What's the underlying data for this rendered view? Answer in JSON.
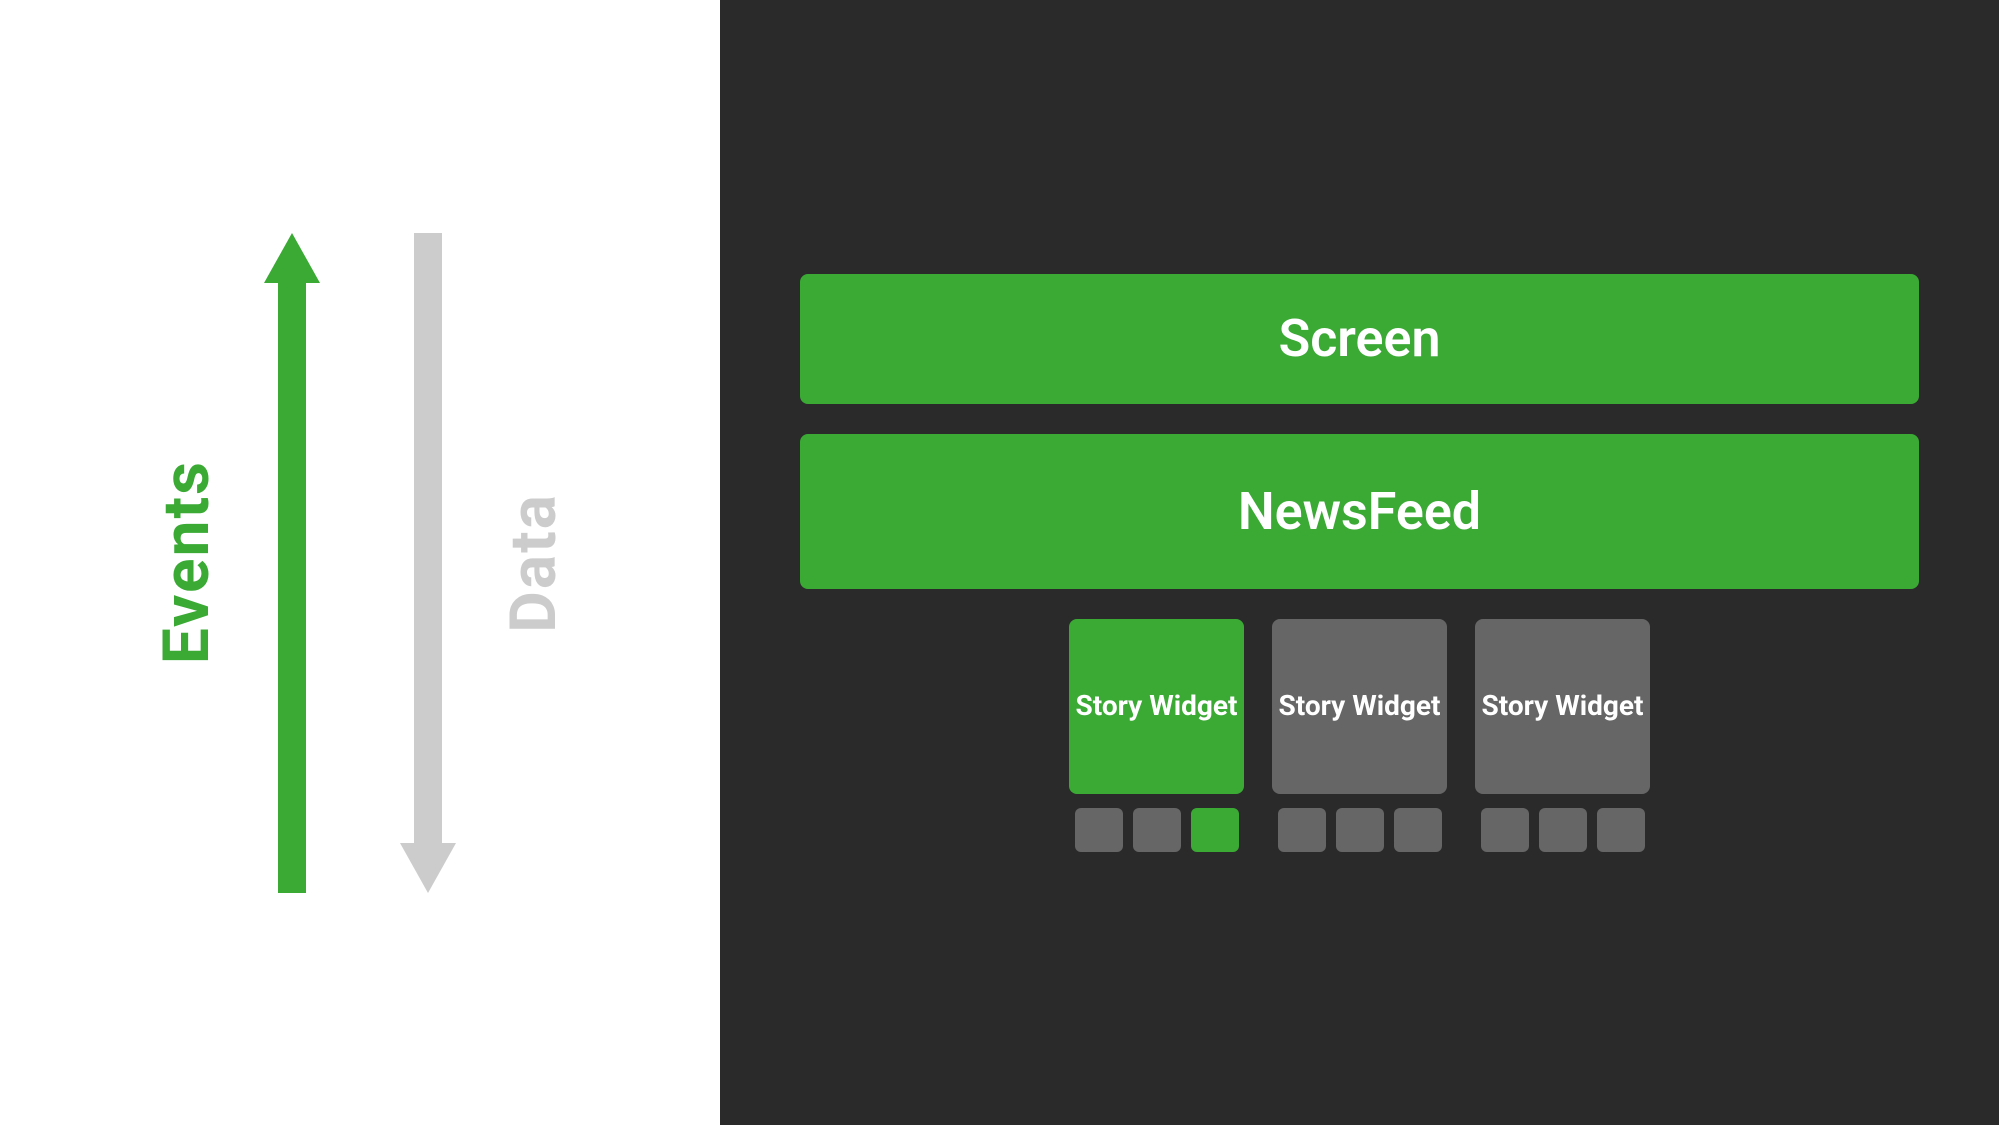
{
  "left": {
    "events_label": "Events",
    "data_label": "Data"
  },
  "right": {
    "screen_label": "Screen",
    "newsfeed_label": "NewsFeed",
    "story_widgets": [
      {
        "label": "Story Widget",
        "color": "green",
        "dots": [
          "gray",
          "gray",
          "green"
        ]
      },
      {
        "label": "Story Widget",
        "color": "gray",
        "dots": [
          "gray",
          "gray",
          "gray"
        ]
      },
      {
        "label": "Story Widget",
        "color": "gray",
        "dots": [
          "gray",
          "gray",
          "gray"
        ]
      }
    ]
  },
  "colors": {
    "green": "#3aaa35",
    "gray": "#666666",
    "white": "#ffffff",
    "dark_bg": "#2a2a2a",
    "light_bg": "#ffffff"
  }
}
